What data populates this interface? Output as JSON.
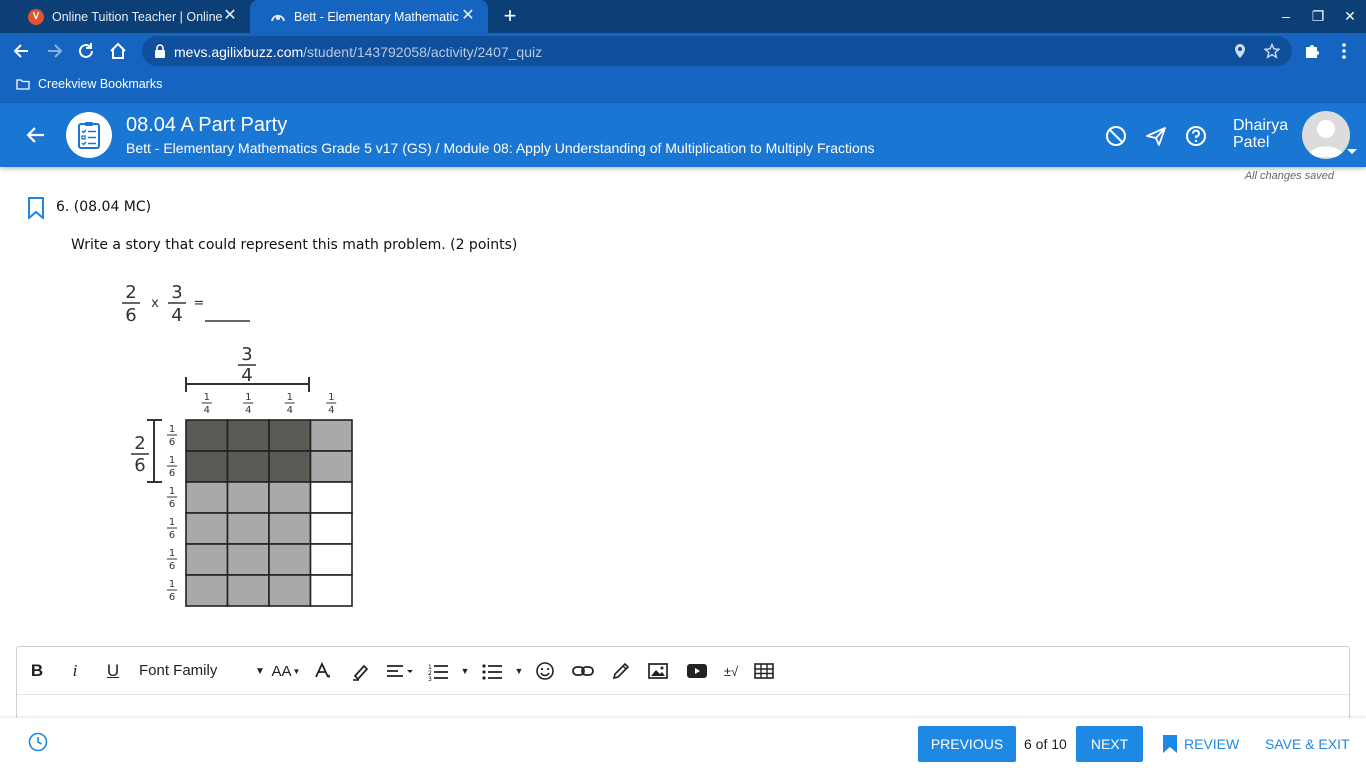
{
  "browser": {
    "tabs": [
      {
        "title": "Online Tuition Teacher | Online Li",
        "favicon_letter": "V",
        "active": false
      },
      {
        "title": "Bett - Elementary Mathematics G",
        "active": true
      }
    ],
    "url_host": "mevs.agilixbuzz.com",
    "url_path": "/student/143792058/activity/2407_quiz",
    "bookmarks": [
      "Creekview Bookmarks"
    ]
  },
  "header": {
    "title": "08.04 A Part Party",
    "breadcrumb": "Bett - Elementary Mathematics Grade 5 v17 (GS) / Module 08: Apply Understanding of Multiplication to Multiply Fractions",
    "user_first": "Dhairya",
    "user_last": "Patel"
  },
  "status": {
    "saved": "All changes saved"
  },
  "question": {
    "number": "6. (08.04 MC)",
    "prompt": "Write a story that could represent this math problem. (2 points)",
    "equation": {
      "a_num": "2",
      "a_den": "6",
      "op": "x",
      "b_num": "3",
      "b_den": "4",
      "eq": "="
    },
    "model": {
      "top_num": "3",
      "top_den": "4",
      "col_labels": [
        "1/4",
        "1/4",
        "1/4",
        "1/4"
      ],
      "side_num": "2",
      "side_den": "6",
      "row_labels": [
        "1/6",
        "1/6",
        "1/6",
        "1/6",
        "1/6",
        "1/6"
      ]
    }
  },
  "editor": {
    "toolbar": {
      "bold": "B",
      "italic": "i",
      "underline": "U",
      "font_family": "Font Family",
      "font_size": "AA"
    }
  },
  "footer": {
    "previous": "PREVIOUS",
    "page": "6 of 10",
    "next": "NEXT",
    "review": "REVIEW",
    "save_exit": "SAVE & EXIT"
  },
  "colors": {
    "tabbar": "#0d3f77",
    "chrome": "#1564c0",
    "header": "#1976d2",
    "button": "#1e88e5"
  }
}
